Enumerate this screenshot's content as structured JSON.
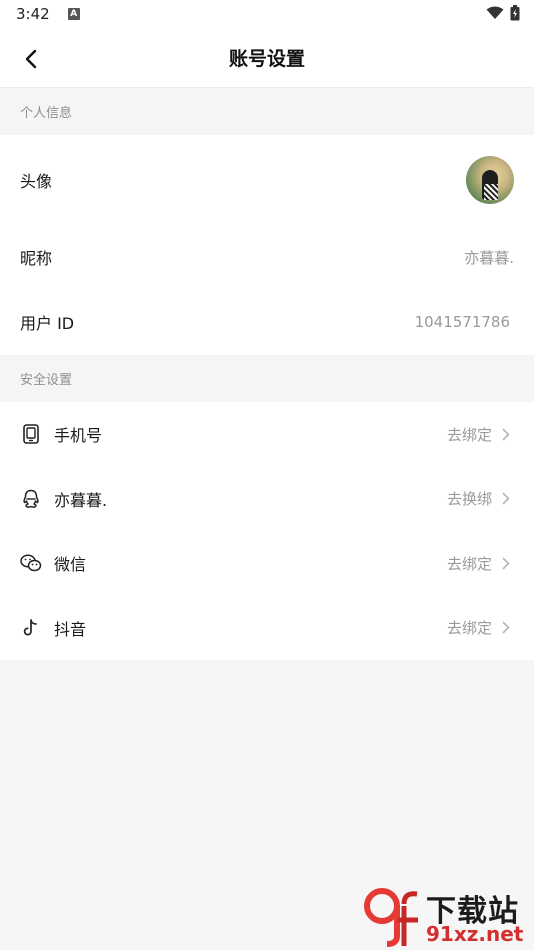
{
  "status_bar": {
    "time": "3:42",
    "notif_letter": "A"
  },
  "header": {
    "title": "账号设置"
  },
  "sections": {
    "personal": {
      "title": "个人信息"
    },
    "security": {
      "title": "安全设置"
    }
  },
  "personal": {
    "avatar_label": "头像",
    "nickname_label": "昵称",
    "nickname_value": "亦暮暮.",
    "uid_label": "用户 ID",
    "uid_value": "1041571786"
  },
  "security": {
    "items": [
      {
        "icon": "phone-icon",
        "label": "手机号",
        "action": "去绑定"
      },
      {
        "icon": "qq-icon",
        "label": "亦暮暮.",
        "action": "去换绑"
      },
      {
        "icon": "wechat-icon",
        "label": "微信",
        "action": "去绑定"
      },
      {
        "icon": "douyin-icon",
        "label": "抖音",
        "action": "去绑定"
      }
    ]
  },
  "watermark": {
    "line1": "下载站",
    "line2": "91xz.net",
    "logo": "9f"
  },
  "colors": {
    "accent_red": "#d32f2f",
    "muted_text": "#9a9a9a",
    "section_bg": "#f5f5f5"
  }
}
